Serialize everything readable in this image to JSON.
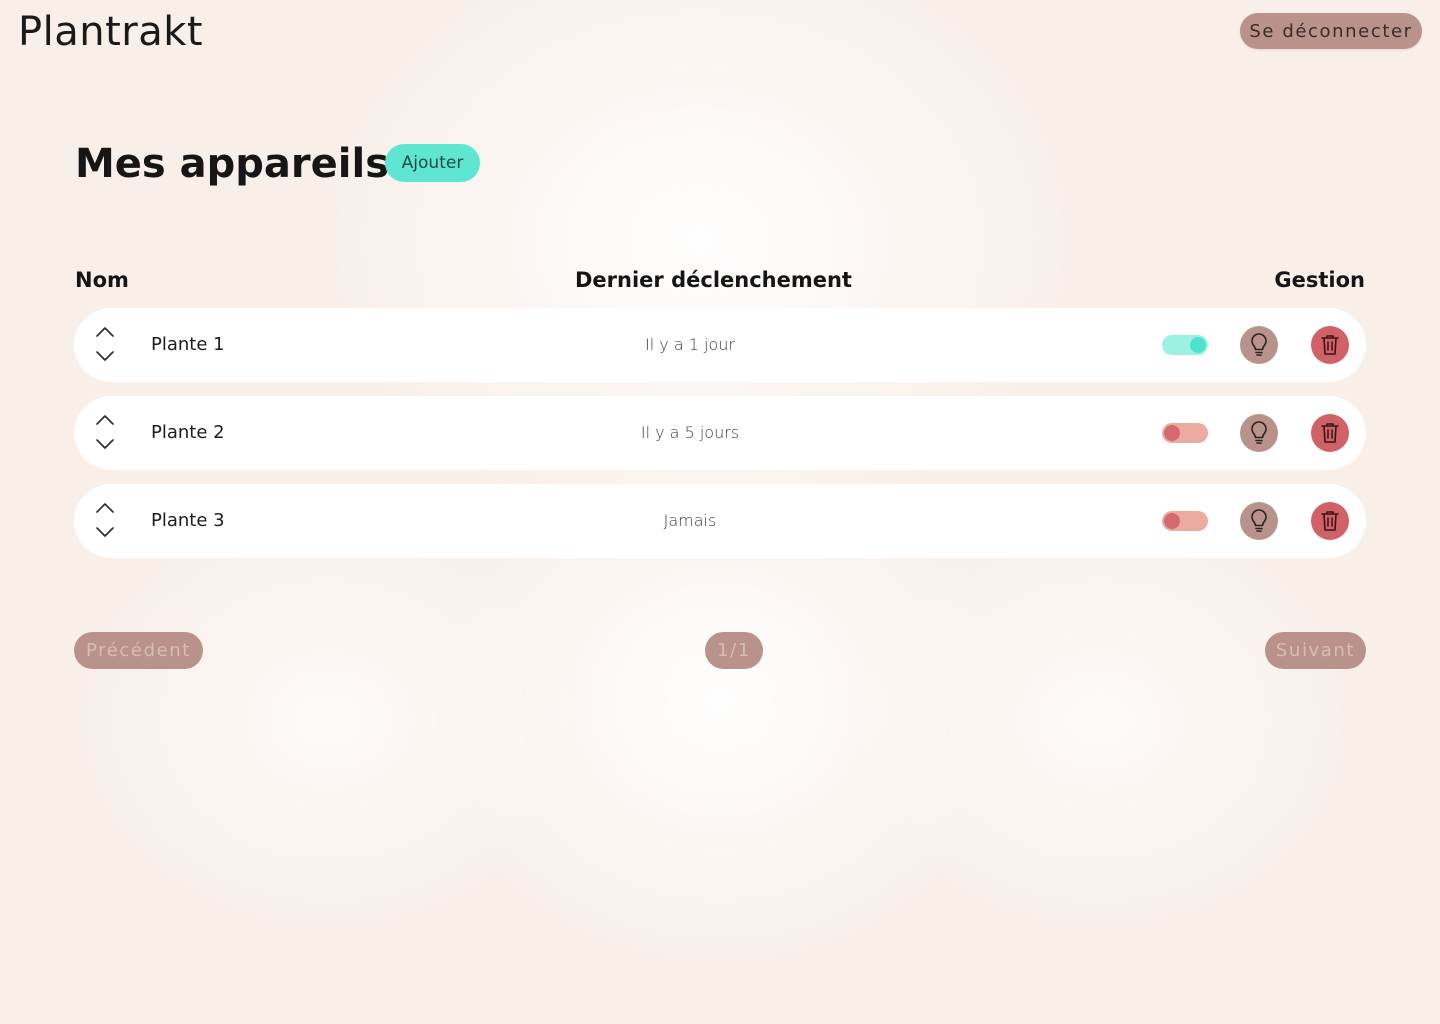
{
  "app": {
    "title": "Plantrakt"
  },
  "header": {
    "logout_label": "Se déconnecter"
  },
  "main": {
    "title": "Mes appareils",
    "add_label": "Ajouter"
  },
  "table": {
    "columns": [
      "Nom",
      "Dernier déclenchement",
      "Gestion"
    ],
    "rows": [
      {
        "name": "Plante 1",
        "last_trigger": "Il y a 1 jour",
        "enabled": true
      },
      {
        "name": "Plante 2",
        "last_trigger": "Il y a 5 jours",
        "enabled": false
      },
      {
        "name": "Plante 3",
        "last_trigger": "Jamais",
        "enabled": false
      }
    ]
  },
  "pagination": {
    "prev_label": "Précédent",
    "page_label": "1/1",
    "next_label": "Suivant"
  },
  "icons": {
    "sort_up": "chevron-up-icon",
    "sort_down": "chevron-down-icon",
    "bulb": "lightbulb-icon",
    "trash": "trash-icon"
  },
  "colors": {
    "accent": "#5ee6d3",
    "muted": "#b9938b",
    "danger": "#d06267",
    "toggle_on": "#9df1e3",
    "toggle_off": "#ebaba0",
    "background": "#f8efe9"
  }
}
